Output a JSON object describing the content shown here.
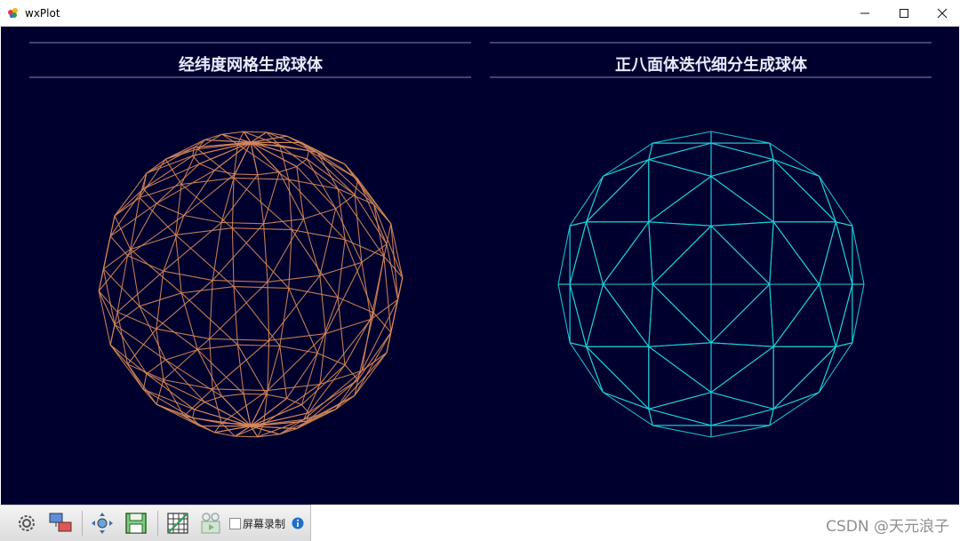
{
  "window": {
    "title": "wxPlot"
  },
  "panels": [
    {
      "title": "经纬度网格生成球体",
      "color": "#d68858",
      "kind": "uv"
    },
    {
      "title": "正八面体迭代细分生成球体",
      "color": "#1fd0da",
      "kind": "octa"
    }
  ],
  "toolbar": {
    "icons": [
      "settings-icon",
      "display-icon",
      "pan-icon",
      "save-icon",
      "grid-icon",
      "video-icon",
      "info-icon"
    ],
    "record_label": "屏幕录制",
    "record_checked": false
  },
  "watermark": "CSDN @天元浪子",
  "colors": {
    "canvas": "#00002e",
    "title_text": "#e6ecff",
    "rule": "#7e8db0"
  }
}
